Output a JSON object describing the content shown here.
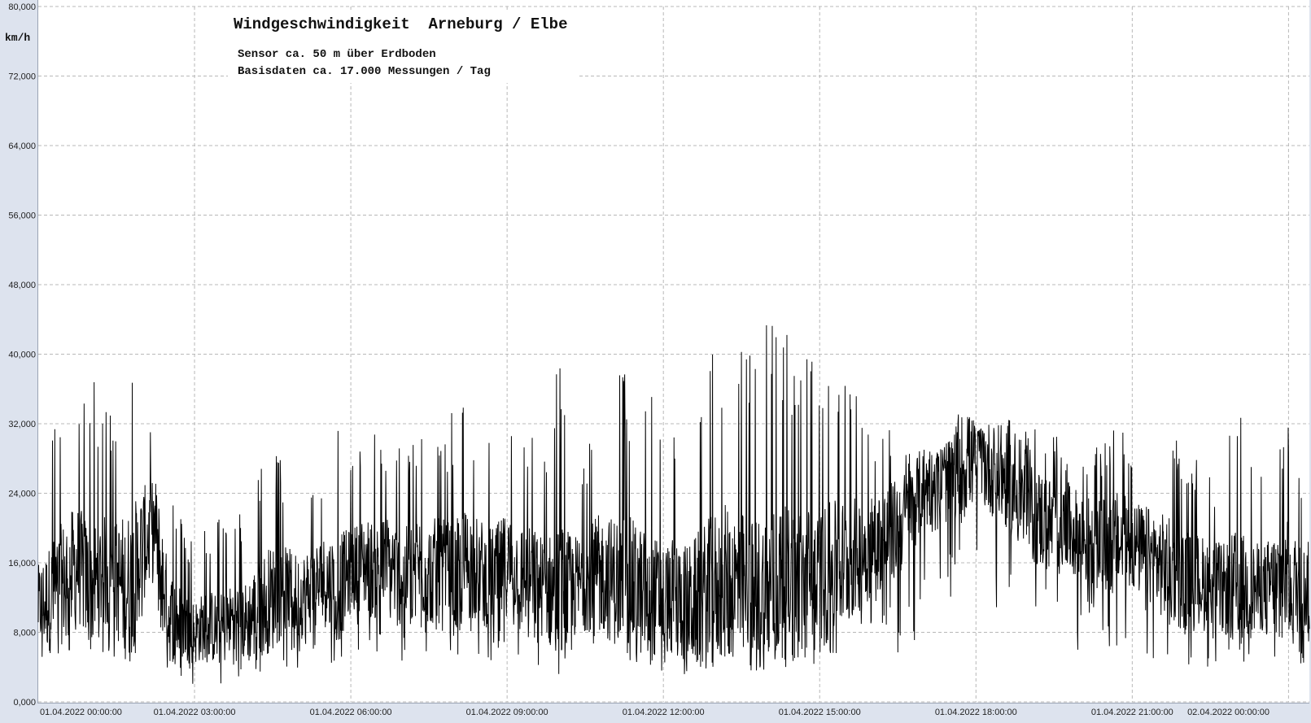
{
  "chart_data": {
    "type": "line",
    "title": "Windgeschwindigkeit  Arneburg / Elbe",
    "subtitle_lines": [
      "Sensor ca. 50 m über Erdboden",
      "Basisdaten ca. 17.000 Messungen / Tag"
    ],
    "ylabel": "km/h",
    "ylim": [
      0,
      80
    ],
    "yticks": [
      "0,000",
      "8,000",
      "16,000",
      "24,000",
      "32,000",
      "40,000",
      "48,000",
      "56,000",
      "64,000",
      "72,000",
      "80,000"
    ],
    "xlim_hours": [
      0,
      24.4
    ],
    "xticks": [
      {
        "hour": 0,
        "label": "01.04.2022  00:00:00"
      },
      {
        "hour": 3,
        "label": "01.04.2022  03:00:00"
      },
      {
        "hour": 6,
        "label": "01.04.2022  06:00:00"
      },
      {
        "hour": 9,
        "label": "01.04.2022  09:00:00"
      },
      {
        "hour": 12,
        "label": "01.04.2022  12:00:00"
      },
      {
        "hour": 15,
        "label": "01.04.2022  15:00:00"
      },
      {
        "hour": 18,
        "label": "01.04.2022  18:00:00"
      },
      {
        "hour": 21,
        "label": "01.04.2022  21:00:00"
      },
      {
        "hour": 24,
        "label": "02.04.2022  00:00:00"
      }
    ],
    "grid": true,
    "series": [
      {
        "name": "",
        "color": "#000000",
        "x_hours_step": 0.25,
        "envelope": {
          "mean": [
            11,
            12,
            14,
            16,
            13,
            15,
            14,
            13,
            18,
            20,
            10,
            9,
            8,
            9,
            8,
            10,
            9,
            11,
            12,
            13,
            12,
            13,
            14,
            13,
            15,
            16,
            15,
            16,
            14,
            16,
            15,
            15,
            14,
            16,
            15,
            14,
            16,
            15,
            14,
            13,
            12,
            13,
            14,
            15,
            14,
            14,
            13,
            12,
            12,
            12,
            11,
            12,
            13,
            14,
            13,
            12,
            13,
            14,
            13,
            14,
            14,
            15,
            16,
            17,
            18,
            19,
            20,
            22,
            25,
            24,
            26,
            27,
            28,
            27,
            26,
            24,
            22,
            21,
            20,
            20,
            19,
            18,
            18,
            18,
            18,
            17,
            16,
            15,
            14,
            14,
            14,
            13,
            13,
            13,
            13,
            14,
            14,
            13,
            13,
            12
          ],
          "low": [
            3,
            4,
            5,
            6,
            4,
            5,
            5,
            4,
            6,
            8,
            3,
            2,
            2,
            3,
            2,
            3,
            2,
            3,
            3,
            4,
            3,
            4,
            5,
            4,
            6,
            6,
            5,
            6,
            4,
            6,
            5,
            5,
            4,
            6,
            5,
            4,
            5,
            5,
            4,
            3,
            3,
            4,
            4,
            5,
            4,
            4,
            4,
            3,
            3,
            3,
            3,
            3,
            4,
            4,
            4,
            3,
            4,
            4,
            4,
            4,
            4,
            5,
            5,
            5,
            6,
            6,
            5,
            6,
            8,
            7,
            8,
            9,
            9,
            8,
            8,
            7,
            6,
            6,
            7,
            6,
            6,
            5,
            5,
            6,
            6,
            5,
            5,
            4,
            4,
            4,
            4,
            4,
            4,
            4,
            4,
            4,
            4,
            4,
            3,
            3
          ],
          "high": [
            24,
            33,
            37,
            36,
            38,
            34,
            36,
            45,
            36,
            34,
            28,
            21,
            19,
            21,
            22,
            20,
            24,
            29,
            31,
            26,
            25,
            27,
            29,
            33,
            28,
            30,
            31,
            32,
            29,
            32,
            33,
            32,
            34,
            36,
            32,
            31,
            32,
            30,
            31,
            29,
            43,
            31,
            30,
            34,
            37,
            39,
            38,
            36,
            32,
            33,
            35,
            40,
            44,
            44,
            44,
            45,
            45,
            44,
            43,
            43,
            42,
            41,
            39,
            35,
            33,
            32,
            31,
            30,
            29,
            29,
            30,
            38,
            31,
            32,
            33,
            32,
            31,
            32,
            32,
            30,
            29,
            29,
            30,
            34,
            29,
            30,
            32,
            31,
            30,
            28,
            26,
            27,
            35,
            30,
            26,
            30,
            35,
            26,
            30,
            28
          ]
        }
      }
    ]
  }
}
